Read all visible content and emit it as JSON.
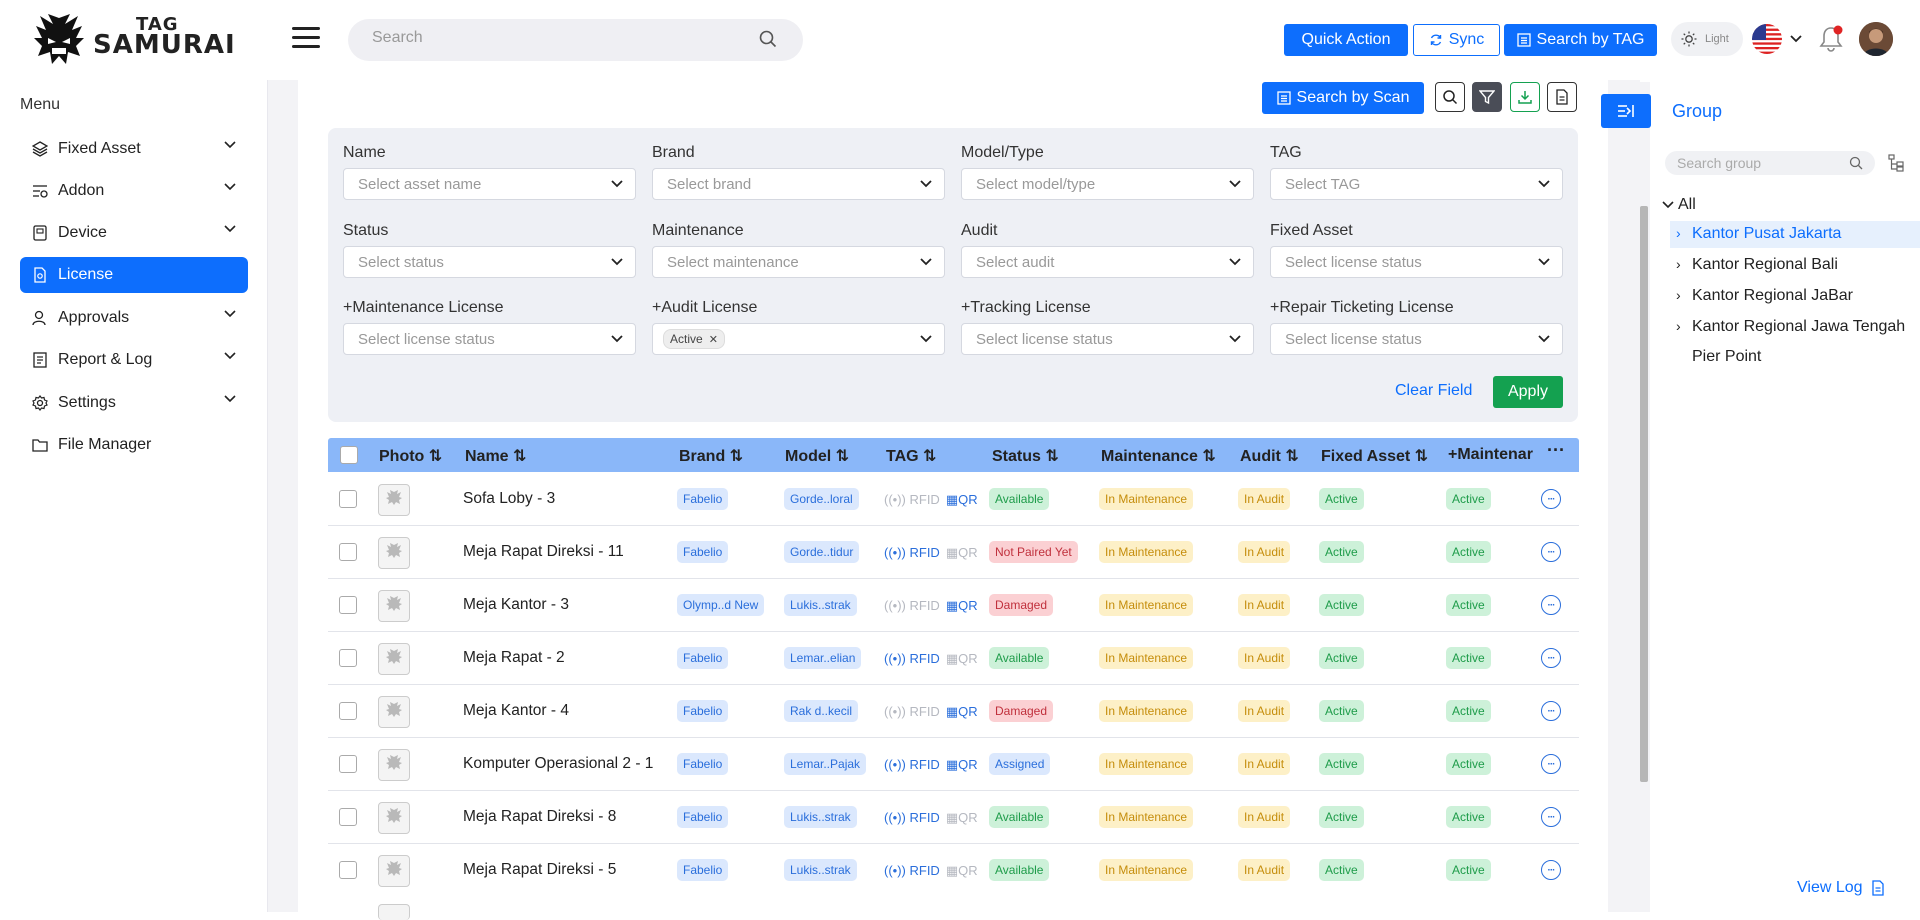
{
  "app": {
    "logo_line1": "TAG",
    "logo_line2": "SAMURAI"
  },
  "header": {
    "search_placeholder": "Search",
    "quick_action": "Quick Action",
    "sync": "Sync",
    "search_by_tag": "Search by TAG",
    "theme": "Light"
  },
  "sidebar": {
    "title": "Menu",
    "items": [
      {
        "label": "Fixed Asset"
      },
      {
        "label": "Addon"
      },
      {
        "label": "Device"
      },
      {
        "label": "License"
      },
      {
        "label": "Approvals"
      },
      {
        "label": "Report & Log"
      },
      {
        "label": "Settings"
      },
      {
        "label": "File Manager"
      }
    ]
  },
  "toolbar": {
    "search_by_scan": "Search by Scan"
  },
  "filters": {
    "name": {
      "label": "Name",
      "placeholder": "Select asset name"
    },
    "brand": {
      "label": "Brand",
      "placeholder": "Select brand"
    },
    "model": {
      "label": "Model/Type",
      "placeholder": "Select model/type"
    },
    "tag": {
      "label": "TAG",
      "placeholder": "Select TAG"
    },
    "status": {
      "label": "Status",
      "placeholder": "Select status"
    },
    "maintenance": {
      "label": "Maintenance",
      "placeholder": "Select maintenance"
    },
    "audit": {
      "label": "Audit",
      "placeholder": "Select audit"
    },
    "fixed_asset": {
      "label": "Fixed Asset",
      "placeholder": "Select license status"
    },
    "maint_license": {
      "label": "+Maintenance License",
      "placeholder": "Select license status"
    },
    "audit_license": {
      "label": "+Audit License",
      "chip": "Active"
    },
    "tracking_license": {
      "label": "+Tracking License",
      "placeholder": "Select license status"
    },
    "repair_license": {
      "label": "+Repair Ticketing License",
      "placeholder": "Select license status"
    },
    "clear": "Clear Field",
    "apply": "Apply"
  },
  "table": {
    "headers": {
      "photo": "Photo ⇅",
      "name": "Name ⇅",
      "brand": "Brand ⇅",
      "model": "Model ⇅",
      "tag": "TAG ⇅",
      "status": "Status ⇅",
      "maintenance": "Maintenance ⇅",
      "audit": "Audit ⇅",
      "fixed_asset": "Fixed Asset ⇅",
      "maint_license": "+Maintenar"
    },
    "rows": [
      {
        "name": "Sofa Loby - 3",
        "brand": "Fabelio",
        "model": "Gorde..loral",
        "rfid": false,
        "qr": true,
        "status": "Available",
        "status_color": "green",
        "maintenance": "In Maintenance",
        "audit": "In Audit",
        "fixed_asset": "Active",
        "maint_license": "Active"
      },
      {
        "name": "Meja Rapat Direksi - 11",
        "brand": "Fabelio",
        "model": "Gorde..tidur",
        "rfid": true,
        "qr": false,
        "status": "Not Paired Yet",
        "status_color": "red",
        "maintenance": "In Maintenance",
        "audit": "In Audit",
        "fixed_asset": "Active",
        "maint_license": "Active"
      },
      {
        "name": "Meja Kantor - 3",
        "brand": "Olymp..d New",
        "model": "Lukis..strak",
        "rfid": false,
        "qr": true,
        "status": "Damaged",
        "status_color": "red",
        "maintenance": "In Maintenance",
        "audit": "In Audit",
        "fixed_asset": "Active",
        "maint_license": "Active"
      },
      {
        "name": "Meja Rapat - 2",
        "brand": "Fabelio",
        "model": "Lemar..elian",
        "rfid": true,
        "qr": false,
        "status": "Available",
        "status_color": "green",
        "maintenance": "In Maintenance",
        "audit": "In Audit",
        "fixed_asset": "Active",
        "maint_license": "Active"
      },
      {
        "name": "Meja Kantor - 4",
        "brand": "Fabelio",
        "model": "Rak d..kecil",
        "rfid": false,
        "qr": true,
        "status": "Damaged",
        "status_color": "red",
        "maintenance": "In Maintenance",
        "audit": "In Audit",
        "fixed_asset": "Active",
        "maint_license": "Active"
      },
      {
        "name": "Komputer Operasional 2 - 1",
        "brand": "Fabelio",
        "model": "Lemar..Pajak",
        "rfid": true,
        "qr": true,
        "status": "Assigned",
        "status_color": "blue",
        "maintenance": "In Maintenance",
        "audit": "In Audit",
        "fixed_asset": "Active",
        "maint_license": "Active"
      },
      {
        "name": "Meja Rapat Direksi - 8",
        "brand": "Fabelio",
        "model": "Lukis..strak",
        "rfid": true,
        "qr": false,
        "status": "Available",
        "status_color": "green",
        "maintenance": "In Maintenance",
        "audit": "In Audit",
        "fixed_asset": "Active",
        "maint_license": "Active"
      },
      {
        "name": "Meja Rapat Direksi - 5",
        "brand": "Fabelio",
        "model": "Lukis..strak",
        "rfid": true,
        "qr": false,
        "status": "Available",
        "status_color": "green",
        "maintenance": "In Maintenance",
        "audit": "In Audit",
        "fixed_asset": "Active",
        "maint_license": "Active"
      }
    ],
    "rfid_label": "RFID",
    "qr_label": "QR"
  },
  "group_panel": {
    "title": "Group",
    "search_placeholder": "Search group",
    "root": "All",
    "items": [
      {
        "label": "Kantor Pusat Jakarta",
        "has_children": true,
        "selected": true
      },
      {
        "label": "Kantor Regional Bali",
        "has_children": true,
        "selected": false
      },
      {
        "label": "Kantor Regional JaBar",
        "has_children": true,
        "selected": false
      },
      {
        "label": "Kantor Regional Jawa Tengah",
        "has_children": true,
        "selected": false
      },
      {
        "label": "Pier Point",
        "has_children": false,
        "selected": false
      }
    ],
    "view_log": "View Log"
  },
  "colors": {
    "accent": "#0d6efd",
    "apply": "#14a150",
    "table_header": "#8ab7f9"
  }
}
